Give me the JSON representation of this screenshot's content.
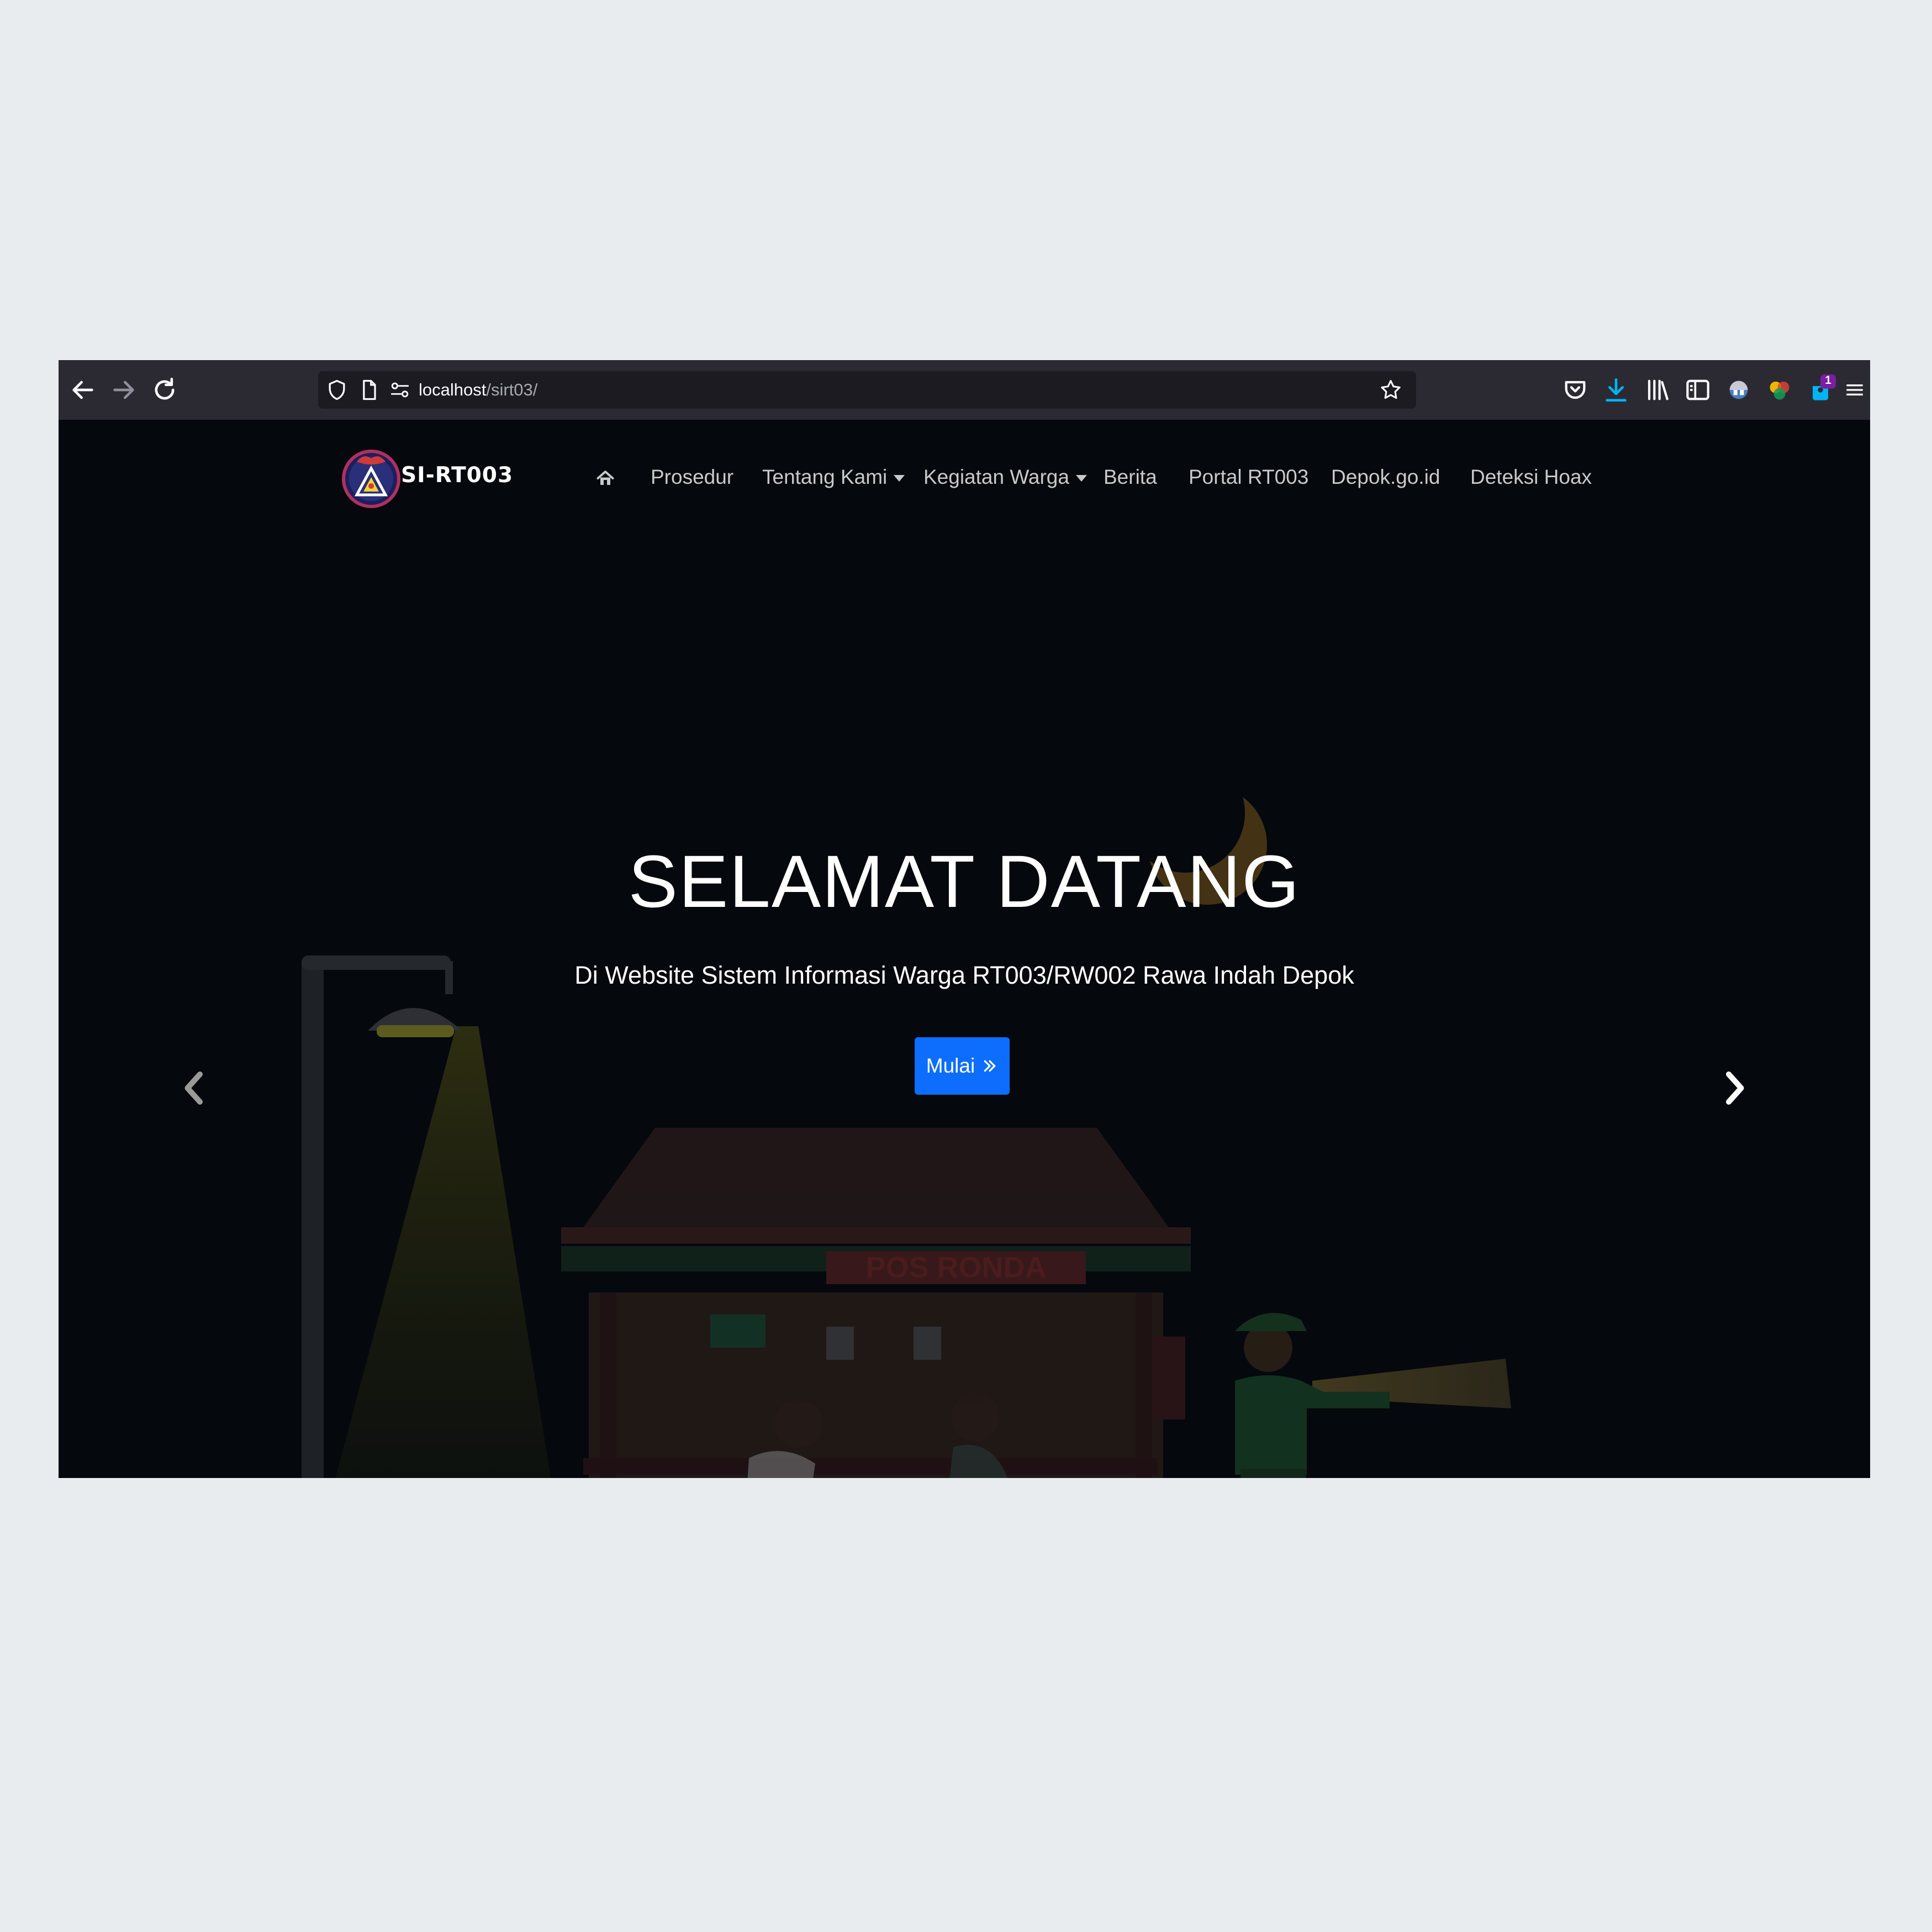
{
  "browser": {
    "url_host": "localhost",
    "url_path": "/sirt03/",
    "download_badge_count": "1"
  },
  "site": {
    "brand": "SI-RT003",
    "nav": {
      "home_icon": "home-icon",
      "items": [
        {
          "label": "Prosedur",
          "dropdown": false
        },
        {
          "label": "Tentang Kami",
          "dropdown": true
        },
        {
          "label": "Kegiatan Warga",
          "dropdown": true
        },
        {
          "label": "Berita",
          "dropdown": false
        },
        {
          "label": "Portal RT003",
          "dropdown": false
        },
        {
          "label": "Depok.go.id",
          "dropdown": false
        },
        {
          "label": "Deteksi Hoax",
          "dropdown": false
        }
      ]
    },
    "hero": {
      "title": "SELAMAT DATANG",
      "subtitle": "Di Website Sistem Informasi Warga RT003/RW002 Rawa Indah Depok",
      "button_label": "Mulai",
      "button_icon": "double-chevron-right-icon",
      "sign_text": "POS RONDA"
    }
  },
  "colors": {
    "page_background": "#e8ecef",
    "browser_toolbar": "#2b2a33",
    "url_field": "#1c1b22",
    "hero_background": "#05090d",
    "button": "#0d6efd",
    "download_icon": "#00b3f4",
    "nav_text": "#c9c9c9"
  }
}
